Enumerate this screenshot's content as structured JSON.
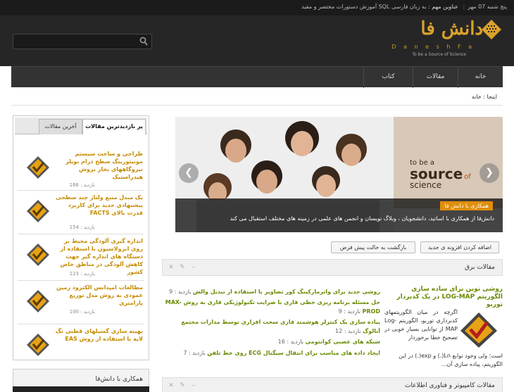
{
  "topbar": {
    "date": "پنج شنبه 07 مهر",
    "headlines_label": "عناوین مهم :",
    "headline": "به زبان فارسی SQL آموزش دستورات مختصر و مفید"
  },
  "search": {
    "placeholder": ""
  },
  "logo": {
    "word": "دانش فا",
    "latin": "D a n e s h   F a",
    "tagline": "To be a Source of Science"
  },
  "nav": {
    "items": [
      "خانه",
      "مقالات",
      "کتاب"
    ]
  },
  "breadcrumb": {
    "text": "اینجا : خانه"
  },
  "tabs": {
    "active": "پر بازدیدترین مقالات",
    "other": "آخرین مقالات"
  },
  "popular": [
    {
      "title": "طراحی و ساخت سیستم مونیتورینگ سطح درام بویلر نیروگاههای بخار بروش هیدراستیک",
      "visits": "بازدید : 166"
    },
    {
      "title": "یک مبدل منبع ولتاژ چند سطحی پیشنهادی جدید برای کاربرد قدرت بالای FACTS",
      "visits": "بازدید : 154"
    },
    {
      "title": "اندازه گیری آلودگی محیط بر روی ایزولاسیون با استفاده از دستگاه های اندازه گیر جهت کاهش آلودگی در مناطق خاص کشور",
      "visits": "بازدید : 123"
    },
    {
      "title": "مطالعات امپدانس الکترود زمین عمودی به روش مدل توزیع پارامتری",
      "visits": "بازدید : 100"
    },
    {
      "title": "بهینه سازی گسیلهای قطبی نگ لایه با استفاده از روش EAS",
      "visits": "بازدید : 100"
    }
  ],
  "coop_box": {
    "title": "همکاری با دانش‌فا"
  },
  "slider": {
    "brand_line1": "to be a",
    "brand_line2": "source",
    "brand_line3": "of",
    "brand_line4": "science",
    "badge": "همکاری با دانش فا",
    "caption": "دانش‌فا از همکاری با اساتید، دانشجویان ، وبلاگ نویسان و انجمن های علمی در زمینه های مختلف استقبال می کند",
    "prev": "❮",
    "next": "❯"
  },
  "buttons": {
    "add_new": "اضافه کردن افزونه ی جدید",
    "reset": "بازگشت به حالت پیش فرض"
  },
  "panel_elec": {
    "title": "مقالات برق"
  },
  "panel_comp": {
    "title": "مقالات کامپیوتر و فناوری اطلاعات"
  },
  "featured": {
    "title": "روشی نوین برای ساده سازی الگوریتم LOG-MAP در یک کدبردار توربو",
    "body": "اگرچه در میان الگوریتمهای کدبرداری توربو، الگوریتم Log-MAP از توانایی بسیار خوبی در تصحیح خطا برخوردار",
    "body2": "است؛ ولی وجود توابع Ln(.) و exp(.) در این الگوریتم، پیاده سازی آن..."
  },
  "news_list": [
    {
      "title": "روشی جدید برای واترمارکینگ کور تصاویر با استفاده از تبدیل والش",
      "visits": "بازدید : 9"
    },
    {
      "title": "حل مسئله برنامه ریزی خطی فازی با ضرایب تکنولوژیکی فازی به روش MAX-PROD",
      "visits": "بازدید : 9"
    },
    {
      "title": "پیاده سازی یک کنترلر هوشمند فازی سخت افزاری توسط مدارات مجتمع آنالوگ",
      "visits": "بازدید : 12"
    },
    {
      "title": "شبکه های عصبی کوانتومی",
      "visits": "بازدید : 16"
    },
    {
      "title": "ایجاد داده های مناسب برای انتقال سیگنال ECG روی خط تلفن",
      "visits": "بازدید : 7"
    }
  ],
  "colors": {
    "accent": "#d9a22b",
    "green_link": "#6a8a00",
    "orange_link": "#c48a00",
    "badge": "#e08e0b"
  },
  "icons": {
    "search": "search-icon",
    "close": "close-icon",
    "wrench": "wrench-icon",
    "minimize": "minimize-icon"
  }
}
